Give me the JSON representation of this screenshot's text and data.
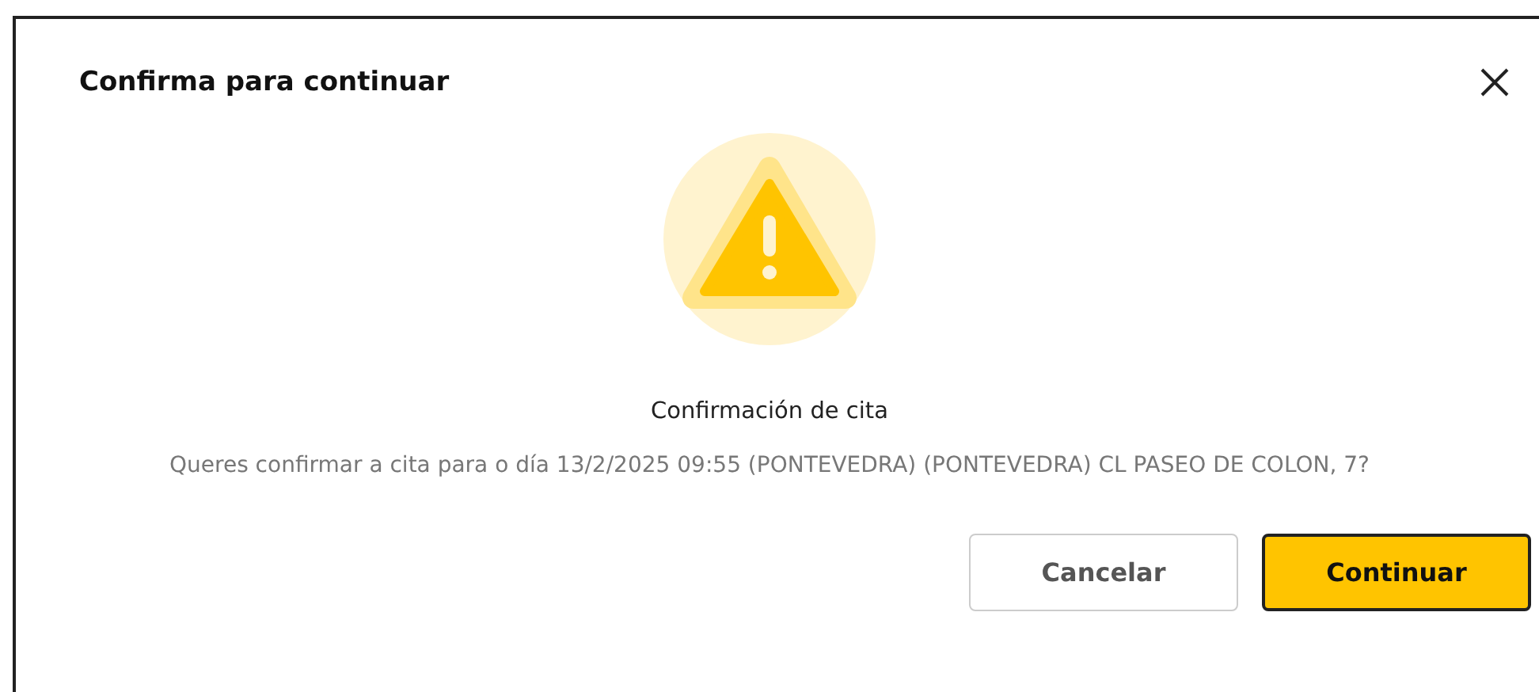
{
  "dialog": {
    "title": "Confirma para continuar",
    "subtitle": "Confirmación de cita",
    "message": "Queres confirmar a cita para o día 13/2/2025 09:55 (PONTEVEDRA) (PONTEVEDRA) CL PASEO DE COLON, 7?",
    "buttons": [
      {
        "label": "Cancelar",
        "kind": "secondary"
      },
      {
        "label": "Continuar",
        "kind": "primary"
      }
    ]
  }
}
